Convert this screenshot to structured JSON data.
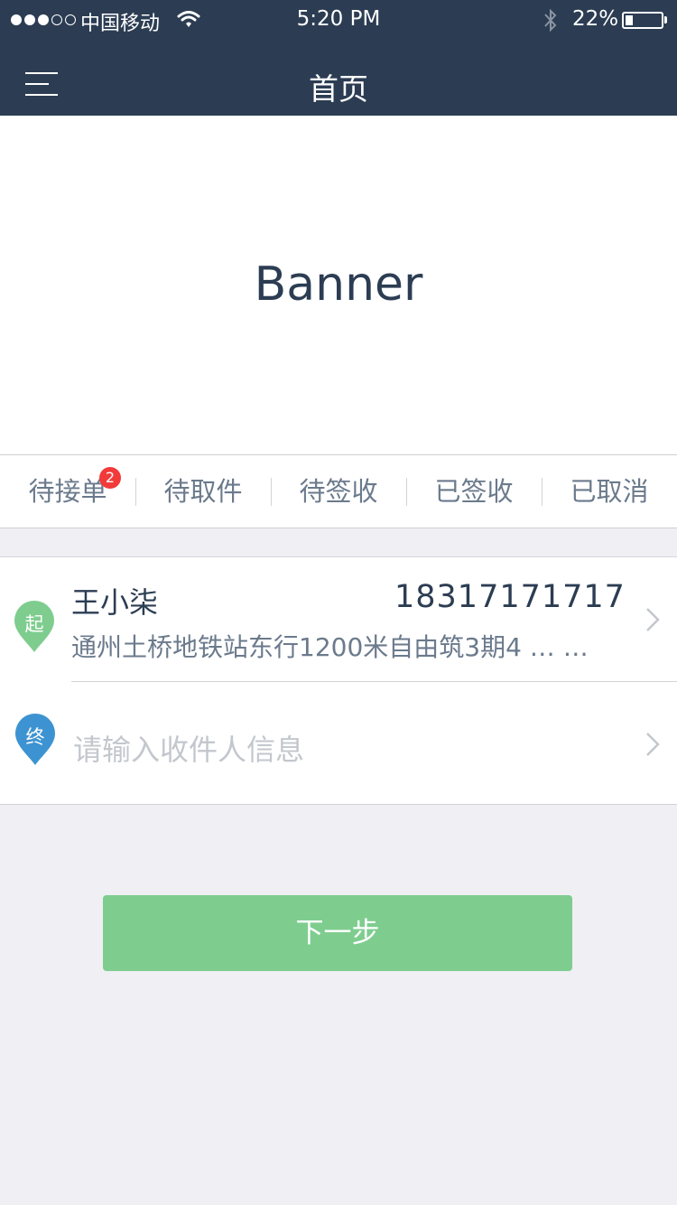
{
  "status_bar": {
    "carrier": "中国移动",
    "time": "5:20 PM",
    "battery_percent": "22%",
    "battery_level": 0.22,
    "signal_bars_filled": 3,
    "signal_bars_total": 5
  },
  "nav": {
    "title": "首页",
    "menu_icon": "hamburger-icon"
  },
  "banner": {
    "text": "Banner"
  },
  "tabs": [
    {
      "label": "待接单",
      "badge": "2"
    },
    {
      "label": "待取件"
    },
    {
      "label": "待签收"
    },
    {
      "label": "已签收"
    },
    {
      "label": "已取消"
    }
  ],
  "sender": {
    "pin_label": "起",
    "name": "王小柒",
    "phone": "18317171717",
    "address": "通州土桥地铁站东行1200米自由筑3期4 … …"
  },
  "receiver": {
    "pin_label": "终",
    "placeholder": "请输入收件人信息"
  },
  "next_button": {
    "label": "下一步"
  },
  "colors": {
    "nav_bg": "#2c3d53",
    "start_pin": "#7ecd8f",
    "end_pin": "#3d93d1",
    "button": "#7ecd8f",
    "badge": "#f23a3a"
  }
}
